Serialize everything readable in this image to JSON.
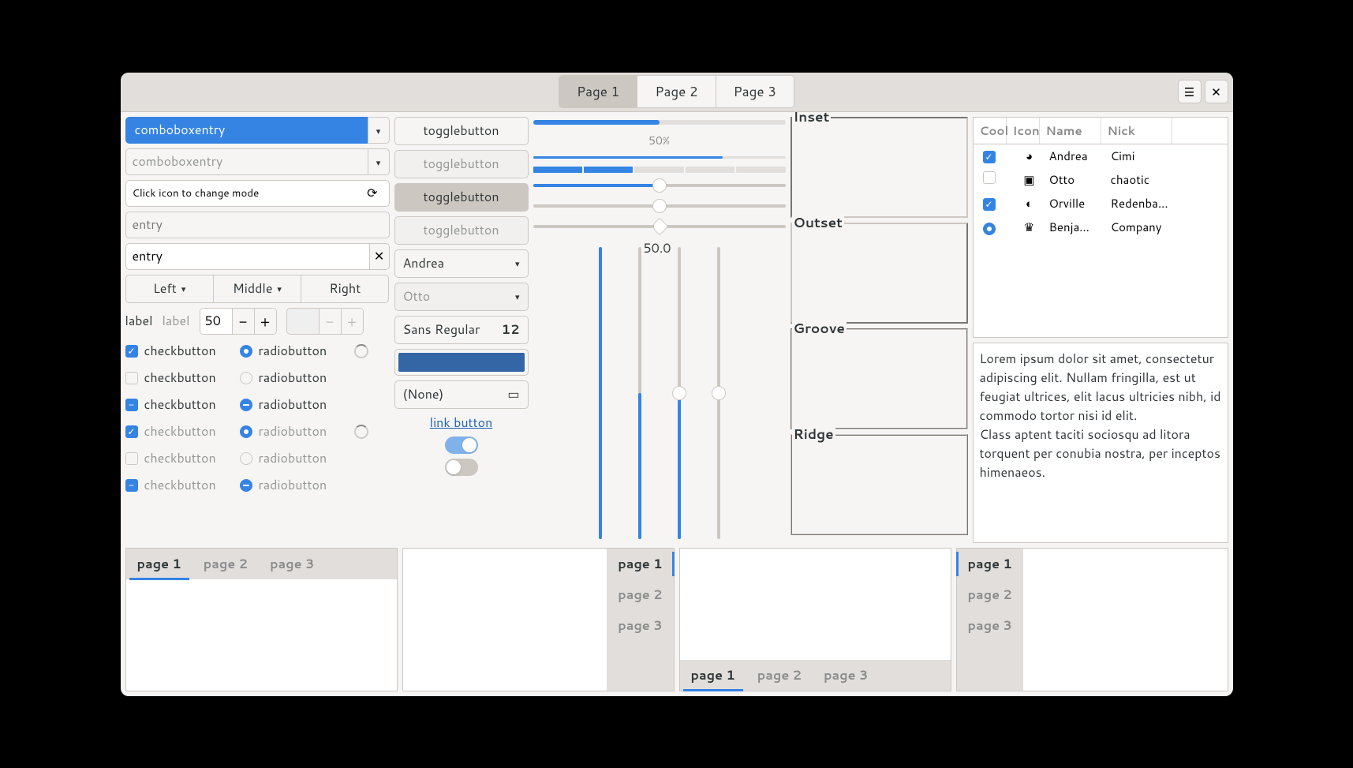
{
  "titlebar": {
    "tabs": [
      "Page 1",
      "Page 2",
      "Page 3"
    ],
    "active_tab": 0,
    "menu_icon": "☰",
    "close_icon": "✕"
  },
  "col1": {
    "combo1_value": "comboboxentry",
    "combo2_value": "comboboxentry",
    "mode_entry": "Click icon to change mode",
    "entry_placeholder": "entry",
    "entry_value": "entry",
    "linked": {
      "left": "Left",
      "middle": "Middle",
      "right": "Right"
    },
    "label1": "label",
    "label2": "label",
    "spin_value": "50",
    "checks": [
      {
        "check": "checked",
        "radio": "checked",
        "spinner": true,
        "dim": false
      },
      {
        "check": "unchecked",
        "radio": "unchecked",
        "spinner": false,
        "dim": false
      },
      {
        "check": "mixed",
        "radio": "mixed",
        "spinner": false,
        "dim": false
      },
      {
        "check": "checked",
        "radio": "checked",
        "spinner": true,
        "dim": true
      },
      {
        "check": "unchecked",
        "radio": "unchecked",
        "spinner": false,
        "dim": true
      },
      {
        "check": "mixed",
        "radio": "mixed",
        "spinner": false,
        "dim": true
      }
    ],
    "check_label": "checkbutton",
    "radio_label": "radiobutton"
  },
  "col2": {
    "toggles": [
      {
        "label": "togglebutton",
        "state": "normal"
      },
      {
        "label": "togglebutton",
        "state": "disabled"
      },
      {
        "label": "togglebutton",
        "state": "toggled"
      },
      {
        "label": "togglebutton",
        "state": "toggled-disabled"
      }
    ],
    "combo_andrea": "Andrea",
    "combo_otto": "Otto",
    "font_name": "Sans Regular",
    "font_size": "12",
    "color": "#3465a4",
    "file_none": "(None)",
    "link_label": "link button"
  },
  "col3": {
    "progress_label": "50%",
    "scale_value": "50.0"
  },
  "col4": {
    "frames": [
      "Inset",
      "Outset",
      "Groove",
      "Ridge"
    ]
  },
  "col5": {
    "headers": {
      "cool": "Cool",
      "icon": "Icon",
      "name": "Name",
      "nick": "Nick"
    },
    "rows": [
      {
        "cool": "checked",
        "icon": "◕",
        "name": "Andrea",
        "nick": "Cimi"
      },
      {
        "cool": "unchecked",
        "icon": "▣",
        "name": "Otto",
        "nick": "chaotic"
      },
      {
        "cool": "checked",
        "icon": "◐",
        "name": "Orville",
        "nick": "Redenba..."
      },
      {
        "cool": "radio",
        "icon": "♛",
        "name": "Benja...",
        "nick": "Company"
      }
    ],
    "lorem": "Lorem ipsum dolor sit amet, consectetur adipiscing elit. Nullam fringilla, est ut feugiat ultrices, elit lacus ultricies nibh, id commodo tortor nisi id elit.\nClass aptent taciti sociosqu ad litora torquent per conubia nostra, per inceptos himenaeos."
  },
  "bottom_tabs": [
    "page 1",
    "page 2",
    "page 3"
  ]
}
